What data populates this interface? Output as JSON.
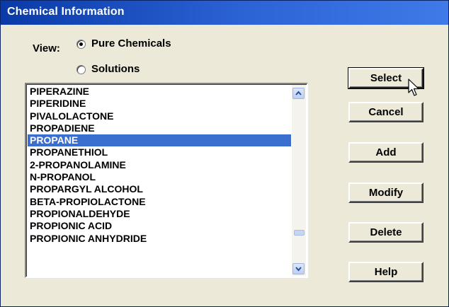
{
  "window": {
    "title": "Chemical Information"
  },
  "view": {
    "label": "View:",
    "options": [
      {
        "label": "Pure Chemicals",
        "selected": true
      },
      {
        "label": "Solutions",
        "selected": false
      }
    ]
  },
  "list": {
    "items": [
      "PIPERAZINE",
      "PIPERIDINE",
      "PIVALOLACTONE",
      "PROPADIENE",
      "PROPANE",
      "PROPANETHIOL",
      "2-PROPANOLAMINE",
      "N-PROPANOL",
      "PROPARGYL ALCOHOL",
      "BETA-PROPIOLACTONE",
      "PROPIONALDEHYDE",
      "PROPIONIC ACID",
      "PROPIONIC ANHYDRIDE"
    ],
    "selected_index": 4
  },
  "buttons": {
    "select": "Select",
    "cancel": "Cancel",
    "add": "Add",
    "modify": "Modify",
    "delete": "Delete",
    "help": "Help"
  },
  "colors": {
    "title_bar": "#2c63d6",
    "selection": "#3a6fcf",
    "face": "#ece9d8"
  },
  "icons": {
    "scroll_up": "chevron-up-icon",
    "scroll_down": "chevron-down-icon",
    "cursor": "mouse-pointer-icon"
  }
}
